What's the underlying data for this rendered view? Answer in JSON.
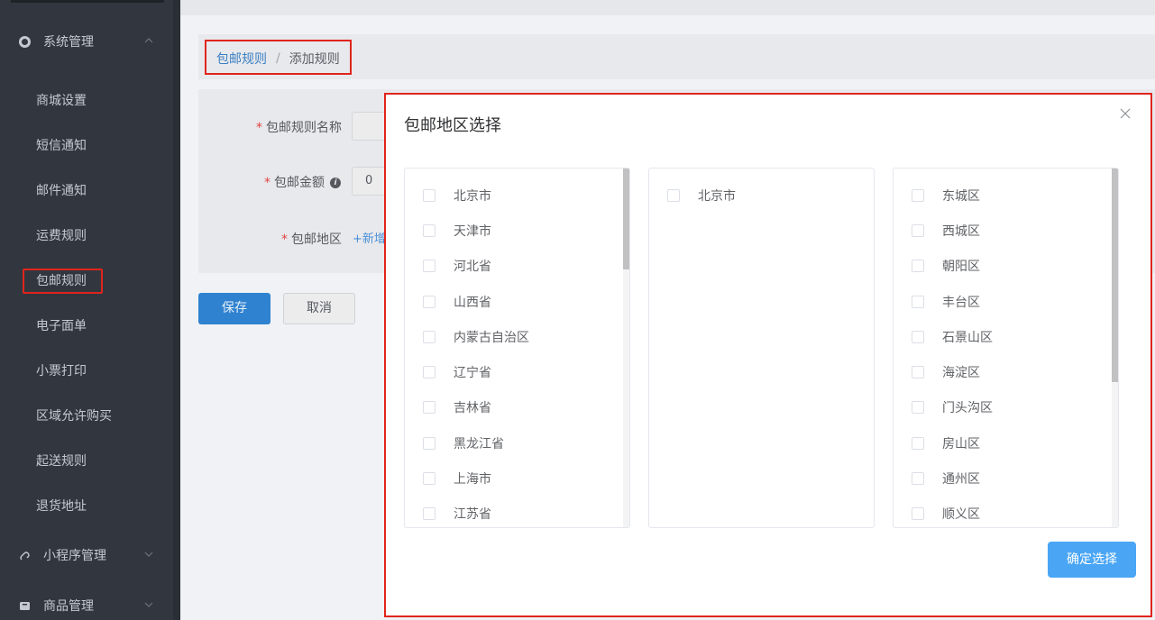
{
  "sidebar": {
    "groups": [
      {
        "label": "系统管理",
        "icon": "gear-icon"
      },
      {
        "label": "小程序管理",
        "icon": "link-icon"
      },
      {
        "label": "商品管理",
        "icon": "box-icon"
      }
    ],
    "items": [
      {
        "label": "商城设置"
      },
      {
        "label": "短信通知"
      },
      {
        "label": "邮件通知"
      },
      {
        "label": "运费规则"
      },
      {
        "label": "包邮规则",
        "active": true
      },
      {
        "label": "电子面单"
      },
      {
        "label": "小票打印"
      },
      {
        "label": "区域允许购买"
      },
      {
        "label": "起送规则"
      },
      {
        "label": "退货地址"
      }
    ]
  },
  "breadcrumb": {
    "parent": "包邮规则",
    "separator": "/",
    "current": "添加规则"
  },
  "form": {
    "name_label": "包邮规则名称",
    "amount_label": "包邮金额",
    "amount_value": "0",
    "region_label": "包邮地区",
    "add_label": "+新增"
  },
  "buttons": {
    "save": "保存",
    "cancel": "取消"
  },
  "dialog": {
    "title": "包邮地区选择",
    "close_icon": "close-icon",
    "provinces": [
      "北京市",
      "天津市",
      "河北省",
      "山西省",
      "内蒙古自治区",
      "辽宁省",
      "吉林省",
      "黑龙江省",
      "上海市",
      "江苏省"
    ],
    "cities": [
      "北京市"
    ],
    "districts": [
      "东城区",
      "西城区",
      "朝阳区",
      "丰台区",
      "石景山区",
      "海淀区",
      "门头沟区",
      "房山区",
      "通州区",
      "顺义区"
    ],
    "confirm_label": "确定选择"
  },
  "colors": {
    "sidebar_bg": "#32373f",
    "accent": "#2f82cf",
    "confirm": "#4aa6f5",
    "highlight_border": "#e0241b",
    "required_star": "#e04545"
  }
}
